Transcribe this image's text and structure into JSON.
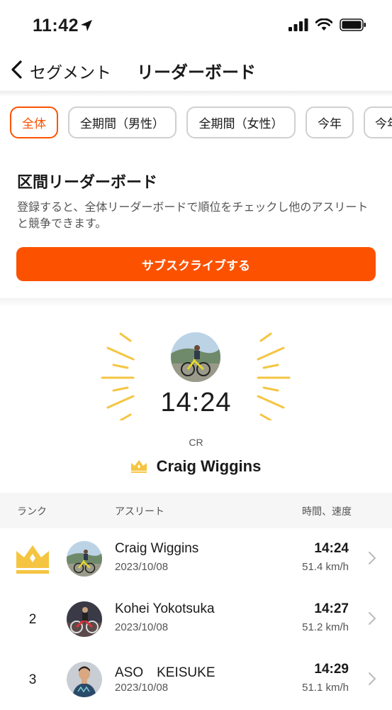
{
  "status_bar": {
    "time": "11:42"
  },
  "nav": {
    "back_label": "セグメント",
    "title": "リーダーボード"
  },
  "filters": [
    {
      "label": "全体",
      "active": true
    },
    {
      "label": "全期間（男性）",
      "active": false
    },
    {
      "label": "全期間（女性）",
      "active": false
    },
    {
      "label": "今年",
      "active": false
    },
    {
      "label": "今年",
      "active": false
    }
  ],
  "promo": {
    "title": "区間リーダーボード",
    "text": "登録すると、全体リーダーボードで順位をチェックし他のアスリートと競争できます。",
    "button_label": "サブスクライブする"
  },
  "course_record": {
    "time": "14:24",
    "label": "CR",
    "holder": "Craig Wiggins"
  },
  "table": {
    "headers": {
      "rank": "ランク",
      "athlete": "アスリート",
      "time_speed": "時間、速度"
    },
    "rows": [
      {
        "rank": "",
        "crown": true,
        "name": "Craig Wiggins",
        "date": "2023/10/08",
        "time": "14:24",
        "speed": "51.4 km/h"
      },
      {
        "rank": "2",
        "crown": false,
        "name": "Kohei Yokotsuka",
        "date": "2023/10/08",
        "time": "14:27",
        "speed": "51.2 km/h"
      },
      {
        "rank": "3",
        "crown": false,
        "name": "ASO　KEISUKE",
        "date": "2023/10/08",
        "time": "14:29",
        "speed": "51.1 km/h"
      }
    ]
  },
  "colors": {
    "accent": "#fc5200",
    "crown": "#f5c542"
  }
}
